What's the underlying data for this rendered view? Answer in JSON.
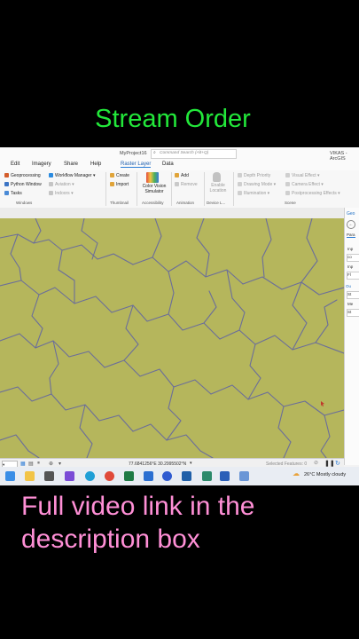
{
  "overlay": {
    "title": "Stream Order",
    "caption": "Full video link in the description box"
  },
  "window": {
    "project": "MyProject16",
    "search_placeholder": "Command Search (Alt+Q)",
    "user": "VIKAS - ArcGIS"
  },
  "menu": [
    "Edit",
    "Imagery",
    "Share",
    "Help",
    "Raster Layer",
    "Data"
  ],
  "ribbon": {
    "geoprocessing": "Geoprocessing",
    "python_window": "Python Window",
    "tasks": "Tasks",
    "workflow_manager": "Workflow Manager",
    "aviation": "Aviation",
    "indoors": "Indoors",
    "create": "Create",
    "import": "Import",
    "color_vision": "Color Vision Simulator",
    "add": "Add",
    "remove": "Remove",
    "enable_location": "Enable Location",
    "depth_priority": "Depth Priority",
    "drawing_mode": "Drawing Mode",
    "illumination": "Illumination",
    "visual_effect": "Visual Effect",
    "camera_effect": "Camera Effect",
    "postprocessing": "Postprocessing Effects",
    "groups": {
      "windows": "Windows",
      "thumbnail": "Thumbnail",
      "accessibility": "Accessibility",
      "animation": "Animation",
      "device": "Device L...",
      "scene": "Scene"
    }
  },
  "right_panel": {
    "header": "Geo",
    "tab": "Para",
    "labels": [
      "Inp",
      "co",
      "Inp",
      "Fl",
      "Ou",
      "St",
      "Me",
      "St"
    ]
  },
  "status": {
    "coords": "77.6841256°E 30.2995502°N",
    "selected": "Selected Features: 0"
  },
  "taskbar": {
    "weather": "26°C  Mostly cloudy"
  },
  "colors": {
    "title": "#22e83a",
    "caption": "#ff8fd6",
    "map_background": "#b5b65c",
    "stream_lines": "#6b6e9a"
  },
  "icons": [
    "geoprocessing-icon",
    "python-icon",
    "tasks-icon",
    "workflow-icon",
    "create-icon",
    "import-icon",
    "color-vision-icon",
    "add-icon",
    "remove-icon",
    "location-icon"
  ]
}
